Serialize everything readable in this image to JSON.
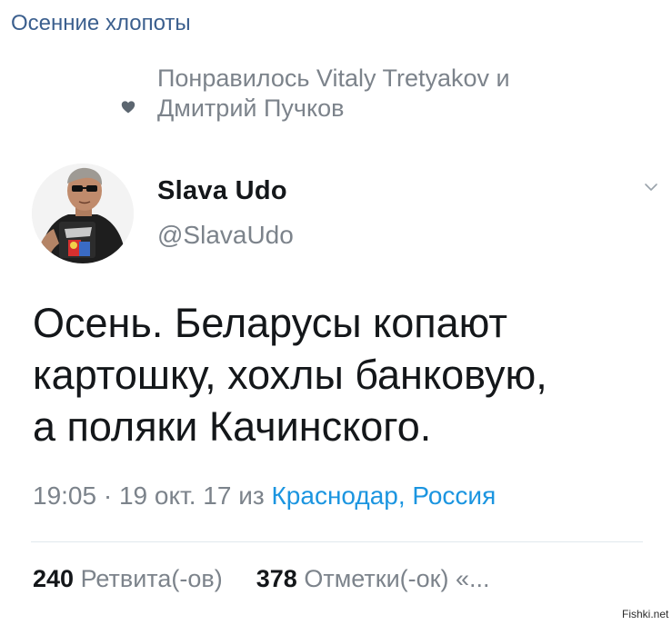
{
  "page": {
    "title": "Осенние хлопоты"
  },
  "liked": {
    "line1": "Понравилось Vitaly Tretyakov и",
    "line2": "Дмитрий Пучков",
    "icon": "heart-icon"
  },
  "author": {
    "name": "Slava Udo",
    "handle": "@SlavaUdo",
    "avatar": "avatar-photo"
  },
  "tweet": {
    "lines": [
      "Осень. Беларусы копают",
      "картошку, хохлы банковую,",
      "а поляки Качинского."
    ]
  },
  "meta": {
    "time": "19:05",
    "separator": "·",
    "date": "19 окт. 17",
    "from": "из",
    "location": "Краснодар, Россия"
  },
  "stats": {
    "retweets_count": "240",
    "retweets_label": "Ретвита(-ов)",
    "likes_count": "378",
    "likes_label": "Отметки(-ок)",
    "more": "«..."
  },
  "watermark": "Fishki.net",
  "colors": {
    "title": "#3b5f8e",
    "muted": "#7c838b",
    "text": "#14171a",
    "link": "#1b95e0",
    "divider": "#e1e8ed"
  }
}
